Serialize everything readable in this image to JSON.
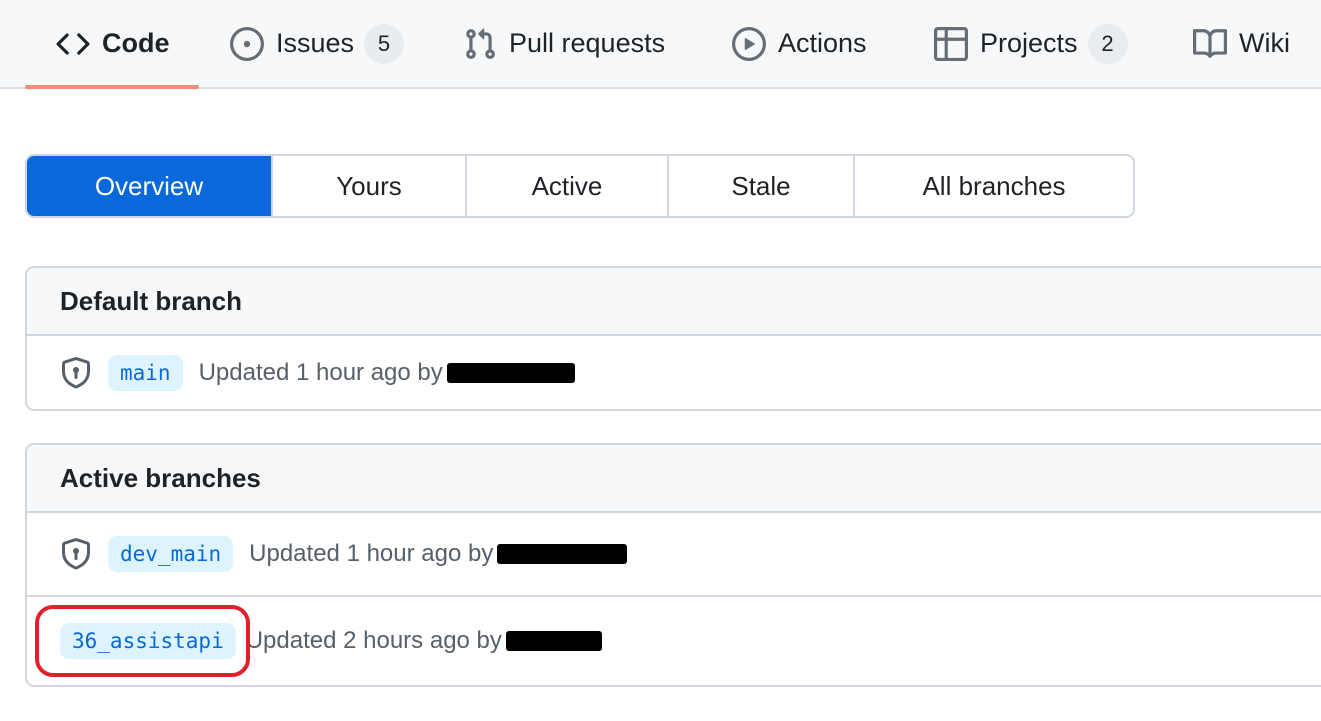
{
  "repo_nav": {
    "items": [
      {
        "label": "Code",
        "icon": "code-icon",
        "selected": true
      },
      {
        "label": "Issues",
        "icon": "issue-opened-icon",
        "counter": "5"
      },
      {
        "label": "Pull requests",
        "icon": "git-pull-request-icon"
      },
      {
        "label": "Actions",
        "icon": "play-icon"
      },
      {
        "label": "Projects",
        "icon": "table-icon",
        "counter": "2"
      },
      {
        "label": "Wiki",
        "icon": "book-icon"
      }
    ]
  },
  "branch_tabs": {
    "items": [
      {
        "label": "Overview",
        "selected": true
      },
      {
        "label": "Yours"
      },
      {
        "label": "Active"
      },
      {
        "label": "Stale"
      },
      {
        "label": "All branches"
      }
    ]
  },
  "default_branch": {
    "title": "Default branch",
    "rows": [
      {
        "name": "main",
        "icon": "shield-lock-icon",
        "updated": "Updated 1 hour ago by",
        "author": "[redacted]"
      }
    ]
  },
  "active_branches": {
    "title": "Active branches",
    "rows": [
      {
        "name": "dev_main",
        "icon": "shield-lock-icon",
        "updated": "Updated 1 hour ago by",
        "author": "[redacted]"
      },
      {
        "name": "36_assistapi",
        "updated": "Updated 2 hours ago by",
        "author": "[redacted]",
        "highlighted": true
      }
    ]
  },
  "colors": {
    "accent": "#0969da",
    "nav_underline": "#fd8c73",
    "branch_bg": "#ddf4ff",
    "highlight": "#e0202a"
  }
}
